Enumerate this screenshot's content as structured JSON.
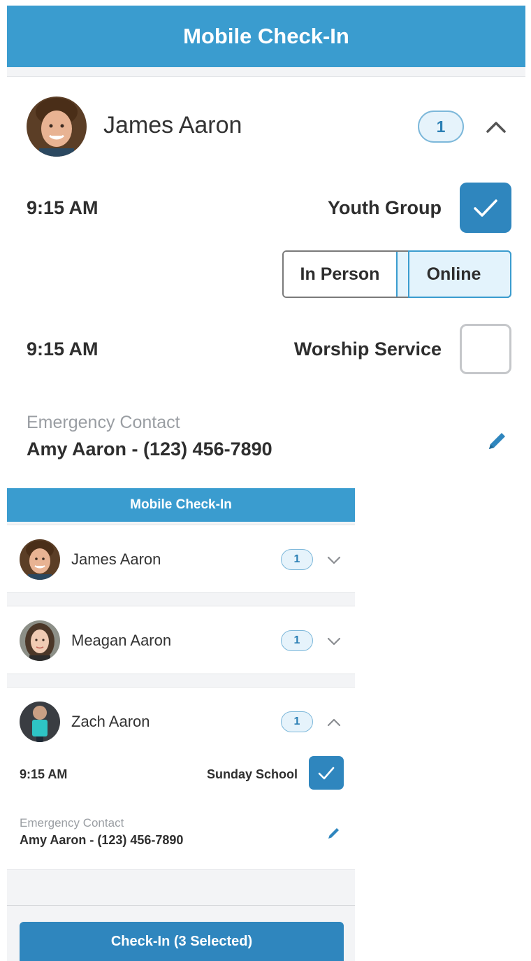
{
  "top": {
    "title": "Mobile Check-In",
    "person": {
      "name": "James Aaron",
      "badge": "1"
    },
    "events": [
      {
        "time": "9:15 AM",
        "name": "Youth Group",
        "checked": true
      },
      {
        "time": "9:15 AM",
        "name": "Worship Service",
        "checked": false
      }
    ],
    "attendance": {
      "options": [
        "In Person",
        "Online"
      ],
      "selected": "Online"
    },
    "emergency": {
      "label": "Emergency Contact",
      "value": "Amy Aaron - (123) 456-7890"
    }
  },
  "bottom": {
    "title": "Mobile Check-In",
    "people": [
      {
        "name": "James Aaron",
        "badge": "1",
        "expanded": false
      },
      {
        "name": "Meagan Aaron",
        "badge": "1",
        "expanded": false
      },
      {
        "name": "Zach Aaron",
        "badge": "1",
        "expanded": true
      }
    ],
    "expanded_event": {
      "time": "9:15 AM",
      "name": "Sunday School",
      "checked": true
    },
    "emergency": {
      "label": "Emergency Contact",
      "value": "Amy Aaron - (123) 456-7890"
    },
    "checkin_button": "Check-In (3 Selected)"
  },
  "colors": {
    "primary": "#3a9ccf",
    "checkbox": "#2f86be",
    "badge_text": "#2b7fb4"
  },
  "icons": {
    "expand": "chevron-up-icon",
    "collapse": "chevron-down-icon",
    "edit": "pencil-icon",
    "check": "checkmark-icon"
  }
}
